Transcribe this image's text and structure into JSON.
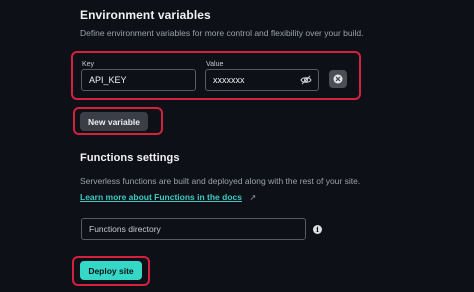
{
  "env": {
    "title": "Environment variables",
    "description": "Define environment variables for more control and flexibility over your build.",
    "key_label": "Key",
    "key_value": "API_KEY",
    "value_label": "Value",
    "value_value": "xxxxxxx",
    "new_variable_label": "New variable"
  },
  "functions": {
    "title": "Functions settings",
    "description": "Serverless functions are built and deployed along with the rest of your site.",
    "docs_link": "Learn more about Functions in the docs",
    "docs_link_arrow": "↗",
    "directory_placeholder": "Functions directory"
  },
  "deploy": {
    "label": "Deploy site"
  },
  "colors": {
    "background": "#0d1117",
    "highlight": "#d4213d",
    "accent": "#35d8c7",
    "link": "#3fc9c0"
  },
  "icons": [
    "eye-off-icon",
    "remove-icon",
    "info-icon",
    "external-link-icon"
  ]
}
